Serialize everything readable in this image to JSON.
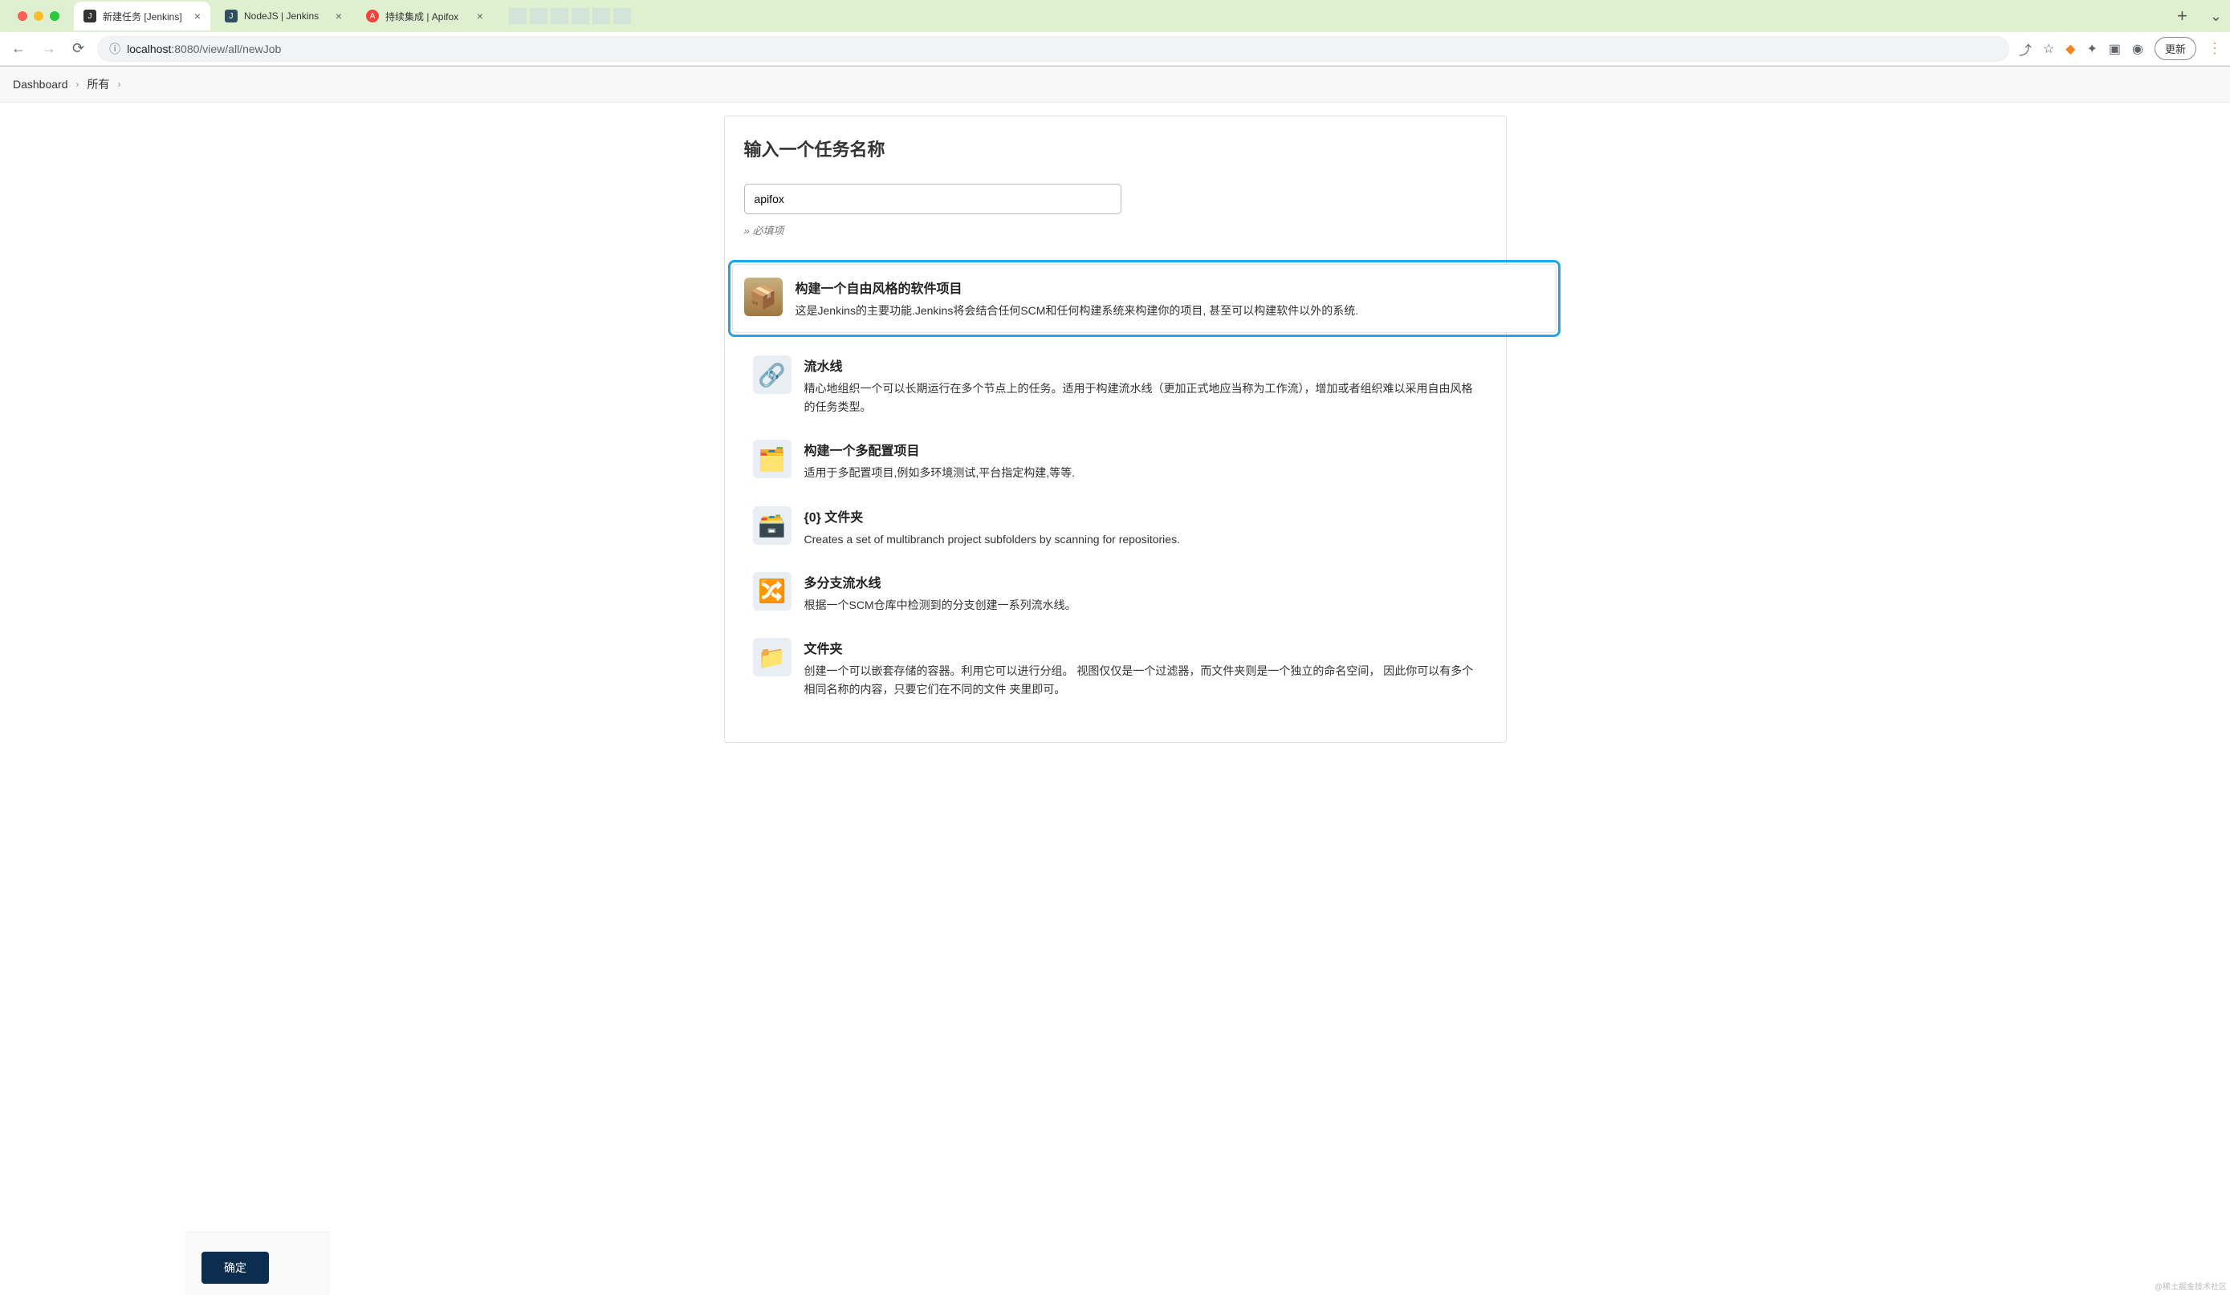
{
  "browser": {
    "tabs": [
      {
        "title": "新建任务 [Jenkins]",
        "favicon_color": "#d03030",
        "active": true
      },
      {
        "title": "NodeJS | Jenkins",
        "favicon_color": "#335061",
        "active": false
      },
      {
        "title": "持续集成 | Apifox",
        "favicon_color": "#f4433a",
        "active": false
      }
    ],
    "url_host": "localhost",
    "url_rest": ":8080/view/all/newJob",
    "update_label": "更新"
  },
  "breadcrumb": {
    "items": [
      "Dashboard",
      "所有"
    ]
  },
  "page": {
    "title": "输入一个任务名称",
    "input_value": "apifox",
    "required_hint": "必填项"
  },
  "items": [
    {
      "title": "构建一个自由风格的软件项目",
      "desc": "这是Jenkins的主要功能.Jenkins将会结合任何SCM和任何构建系统来构建你的项目, 甚至可以构建软件以外的系统.",
      "icon": "📦",
      "selected": true
    },
    {
      "title": "流水线",
      "desc": "精心地组织一个可以长期运行在多个节点上的任务。适用于构建流水线（更加正式地应当称为工作流），增加或者组织难以采用自由风格的任务类型。",
      "icon": "🔗",
      "selected": false
    },
    {
      "title": "构建一个多配置项目",
      "desc": "适用于多配置项目,例如多环境测试,平台指定构建,等等.",
      "icon": "🗂️",
      "selected": false
    },
    {
      "title": "{0} 文件夹",
      "desc": "Creates a set of multibranch project subfolders by scanning for repositories.",
      "icon": "🗃️",
      "selected": false
    },
    {
      "title": "多分支流水线",
      "desc": "根据一个SCM仓库中检测到的分支创建一系列流水线。",
      "icon": "🔀",
      "selected": false
    },
    {
      "title": "文件夹",
      "desc": "创建一个可以嵌套存储的容器。利用它可以进行分组。 视图仅仅是一个过滤器，而文件夹则是一个独立的命名空间， 因此你可以有多个相同名称的内容，只要它们在不同的文件 夹里即可。",
      "icon": "📁",
      "selected": false
    }
  ],
  "footer": {
    "ok_label": "确定"
  },
  "watermark": "@稀土掘金技术社区"
}
